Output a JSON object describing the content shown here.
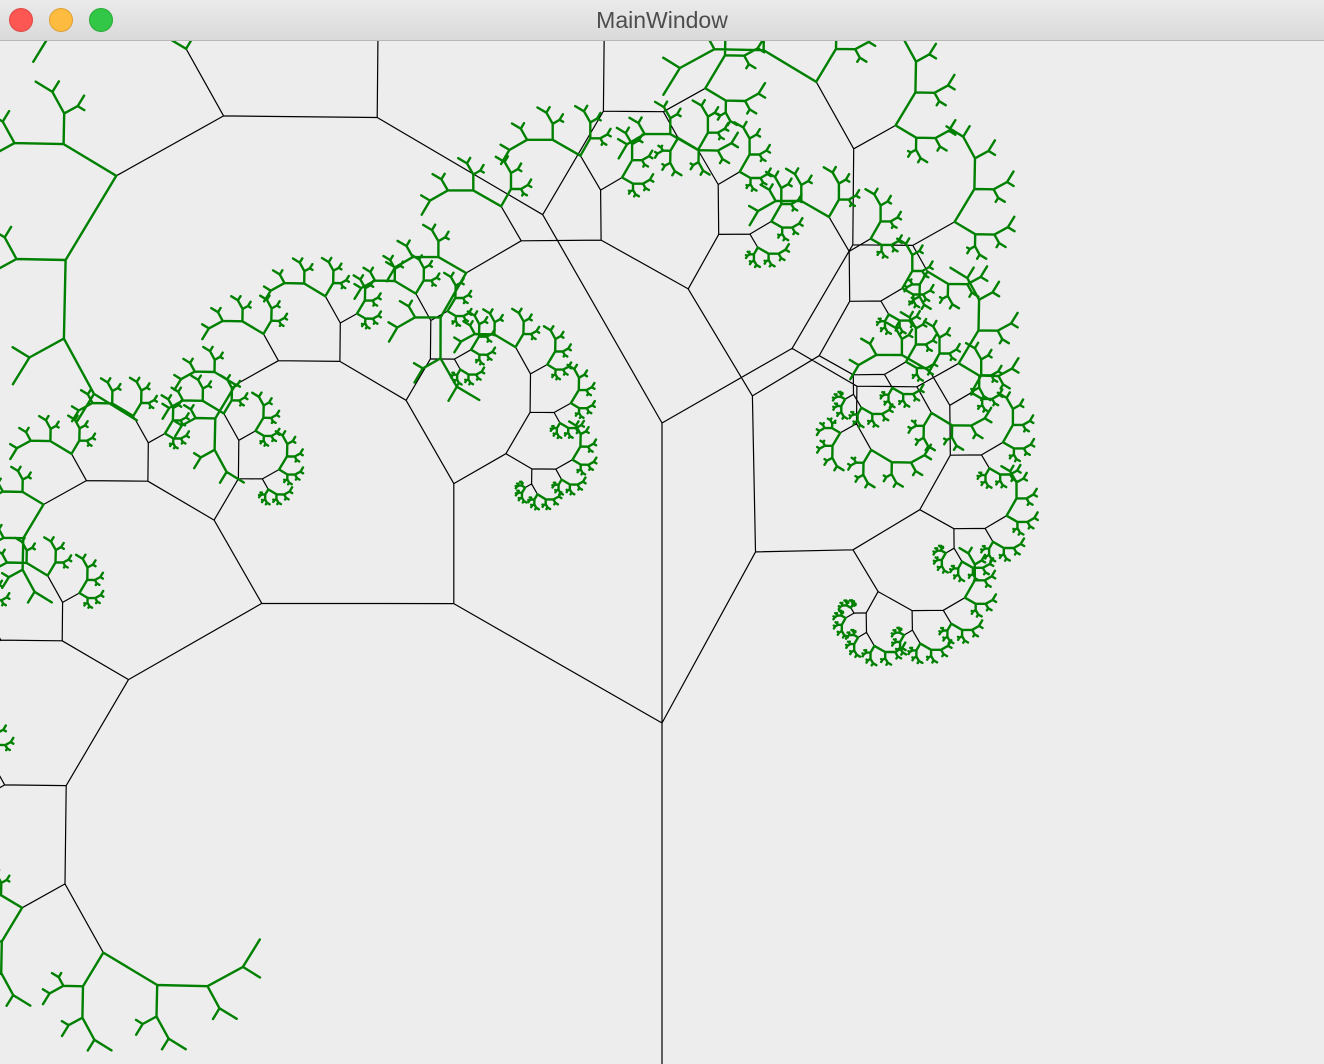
{
  "window": {
    "title": "MainWindow",
    "controls": {
      "close": "close-button",
      "minimize": "minimize-button",
      "maximize": "zoom-button"
    }
  },
  "colors": {
    "background": "#ededed",
    "branch": "#000000",
    "leaf": "#008000",
    "close": "#fc5753",
    "minimize": "#fdbc40",
    "maximize": "#33c748"
  }
}
